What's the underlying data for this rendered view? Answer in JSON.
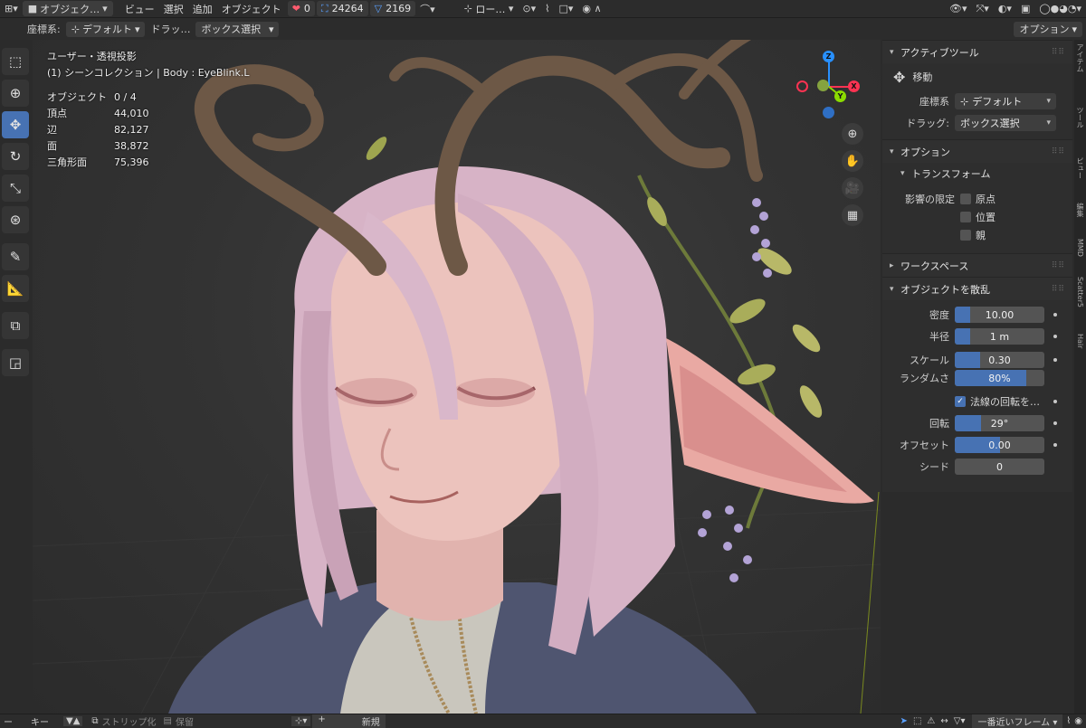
{
  "header": {
    "mode": "オブジェク…",
    "menus": [
      "ビュー",
      "選択",
      "追加",
      "オブジェクト"
    ],
    "stat_a": "0",
    "stat_b": "24264",
    "stat_c": "2169",
    "pivot": "ロー…",
    "options_btn": "オプション"
  },
  "header2": {
    "coord_label": "座標系:",
    "coord_value": "デフォルト",
    "drag_label": "ドラッ…",
    "drag_value": "ボックス選択"
  },
  "viewport": {
    "view_name": "ユーザー・透視投影",
    "collection": "(1) シーンコレクション | Body : EyeBlink.L",
    "stats": [
      {
        "label": "オブジェクト",
        "value": "0 / 4"
      },
      {
        "label": "頂点",
        "value": "44,010"
      },
      {
        "label": "辺",
        "value": "82,127"
      },
      {
        "label": "面",
        "value": "38,872"
      },
      {
        "label": "三角形面",
        "value": "75,396"
      }
    ]
  },
  "gizmo": {
    "x": "X",
    "y": "Y",
    "z": "Z"
  },
  "panel": {
    "active_tool": {
      "title": "アクティブツール",
      "tool_name": "移動",
      "coord_label": "座標系",
      "coord_value": "デフォルト",
      "drag_label": "ドラッグ:",
      "drag_value": "ボックス選択"
    },
    "options": {
      "title": "オプション",
      "transform_title": "トランスフォーム",
      "affect_label": "影響の限定",
      "checks": [
        {
          "label": "原点",
          "checked": false
        },
        {
          "label": "位置",
          "checked": false
        },
        {
          "label": "親",
          "checked": false
        }
      ]
    },
    "workspace": {
      "title": "ワークスペース"
    },
    "scatter": {
      "title": "オブジェクトを散乱",
      "density": {
        "label": "密度",
        "value": "10.00",
        "fill": 0.17
      },
      "radius": {
        "label": "半径",
        "value": "1 m",
        "fill": 0.17
      },
      "scale": {
        "label": "スケール",
        "value": "0.30",
        "fill": 0.28
      },
      "randomness": {
        "label": "ランダムさ",
        "value": "80%",
        "fill": 0.8
      },
      "normal_rotation": {
        "label": "法線の回転を…",
        "checked": true
      },
      "rotation": {
        "label": "回転",
        "value": "29°",
        "fill": 0.29
      },
      "offset": {
        "label": "オフセット",
        "value": "0.00",
        "fill": 0.5
      },
      "seed": {
        "label": "シード",
        "value": "0",
        "fill": 0
      }
    }
  },
  "sidetabs": [
    "アイテム",
    "ツール",
    "ビュー",
    "編集",
    "MMD",
    "Scatter5",
    "Hair"
  ],
  "bottom": {
    "items": [
      "ー",
      "キー",
      "ストリップ化",
      "保留",
      "新規",
      "一番近いフレーム"
    ]
  },
  "colors": {
    "accent": "#4772b3",
    "axis_x": "#ff3352",
    "axis_y": "#8bdc00",
    "axis_z": "#2890ff"
  }
}
